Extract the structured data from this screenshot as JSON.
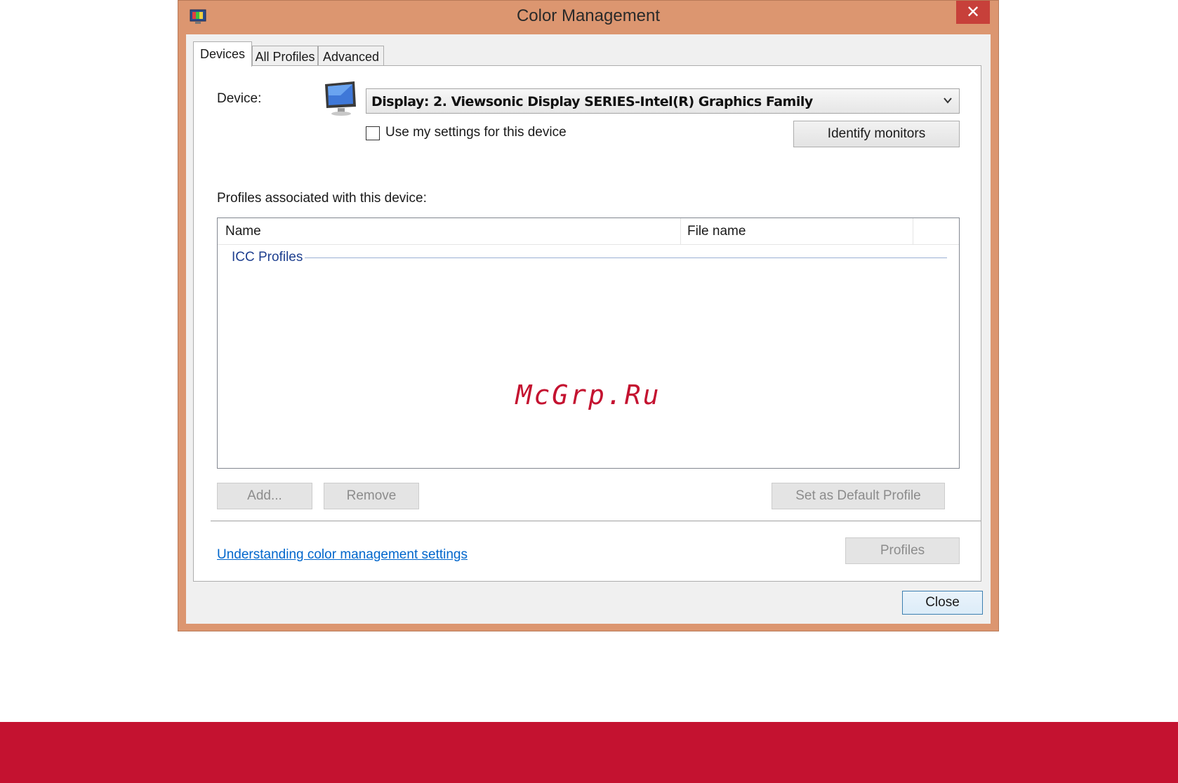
{
  "window": {
    "title": "Color Management",
    "close_glyph": "✕",
    "title_icon": "color-management-icon",
    "accent_color": "#dc9670"
  },
  "tabs": [
    {
      "label": "Devices",
      "active": true
    },
    {
      "label": "All Profiles",
      "active": false
    },
    {
      "label": "Advanced",
      "active": false
    }
  ],
  "devices": {
    "device_label": "Device:",
    "device_value": "Display: 2. Viewsonic Display SERIES-Intel(R) Graphics Family",
    "use_my_settings_label": "Use my settings for this device",
    "use_my_settings_checked": false,
    "identify_button": "Identify monitors",
    "profiles_label": "Profiles associated with this device:",
    "columns": [
      "Name",
      "File name"
    ],
    "group_label": "ICC Profiles",
    "add_button": "Add...",
    "remove_button": "Remove",
    "set_default_button": "Set as Default Profile",
    "help_link": "Understanding color management settings",
    "profiles_button": "Profiles"
  },
  "footer": {
    "close_button": "Close"
  },
  "watermark": "McGrp.Ru",
  "brand_bar_color": "#c41230"
}
